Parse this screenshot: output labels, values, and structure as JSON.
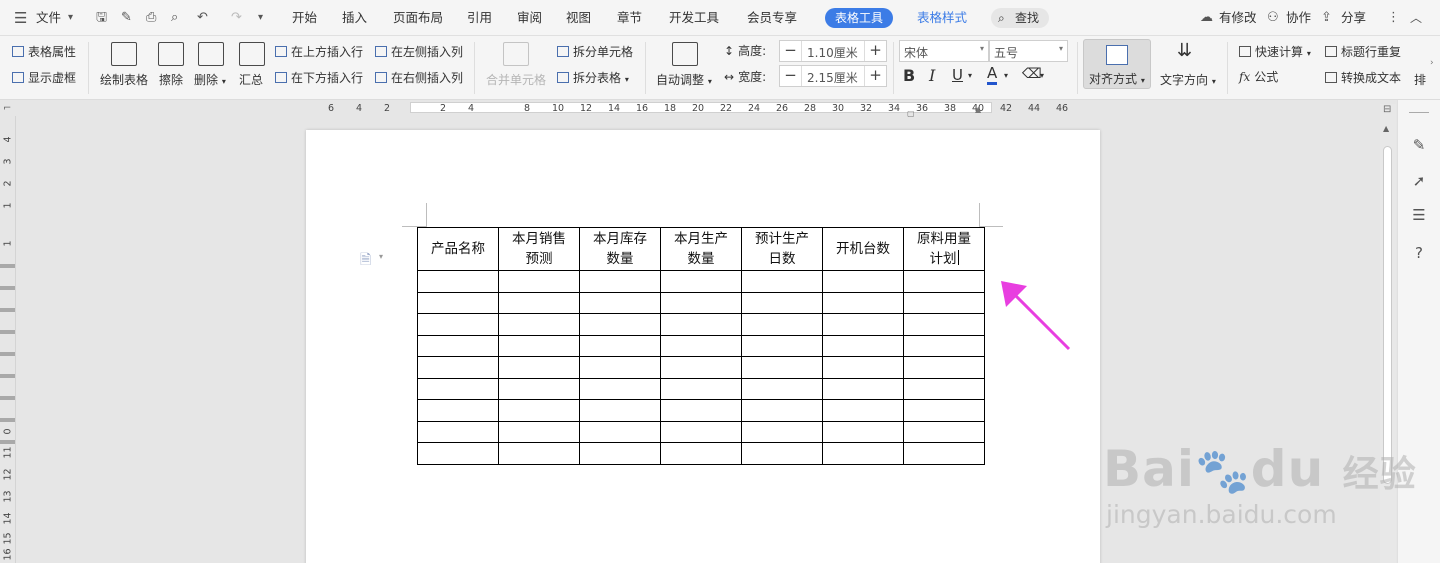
{
  "menubar": {
    "file": "文件",
    "tabs": [
      "开始",
      "插入",
      "页面布局",
      "引用",
      "审阅",
      "视图",
      "章节",
      "开发工具",
      "会员专享"
    ],
    "table_tools": "表格工具",
    "table_style": "表格样式",
    "search": "查找",
    "has_changes": "有修改",
    "collaborate": "协作",
    "share": "分享"
  },
  "ribbon": {
    "table_props": "表格属性",
    "show_grid": "显示虚框",
    "draw_table": "绘制表格",
    "erase": "擦除",
    "delete": "删除",
    "summary": "汇总",
    "insert_above": "在上方插入行",
    "insert_below": "在下方插入行",
    "insert_left": "在左侧插入列",
    "insert_right": "在右侧插入列",
    "merge_cells": "合并单元格",
    "split_cells": "拆分单元格",
    "split_table": "拆分表格",
    "auto_fit": "自动调整",
    "height_label": "高度:",
    "height_value": "1.10厘米",
    "width_label": "宽度:",
    "width_value": "2.15厘米",
    "font_name": "宋体",
    "font_size": "五号",
    "align": "对齐方式",
    "text_direction": "文字方向",
    "quick_calc": "快速计算",
    "formula": "公式",
    "repeat_header": "标题行重复",
    "to_text": "转换成文本",
    "more": "排"
  },
  "ruler": {
    "h_ticks": [
      "6",
      "4",
      "2",
      "2",
      "4",
      "8",
      "10",
      "12",
      "14",
      "16",
      "18",
      "20",
      "22",
      "24",
      "26",
      "28",
      "30",
      "32",
      "34",
      "36",
      "38",
      "40",
      "42",
      "44",
      "46"
    ],
    "v_ticks": [
      "4",
      "3",
      "2",
      "1",
      "1",
      "0",
      "11",
      "12",
      "13",
      "14",
      "15",
      "16"
    ]
  },
  "table": {
    "headers": [
      [
        "产品名称",
        ""
      ],
      [
        "本月销售",
        "预测"
      ],
      [
        "本月库存",
        "数量"
      ],
      [
        "本月生产",
        "数量"
      ],
      [
        "预计生产",
        "日数"
      ],
      [
        "开机台数",
        ""
      ],
      [
        "原料用量",
        "计划"
      ]
    ],
    "empty_rows": 9
  },
  "watermark": {
    "brand_left": "Bai",
    "brand_right": "du",
    "brand_cn": "经验",
    "url": "jingyan.baidu.com"
  },
  "colors": {
    "accent": "#3c7ce6",
    "arrow": "#e83ee0"
  }
}
